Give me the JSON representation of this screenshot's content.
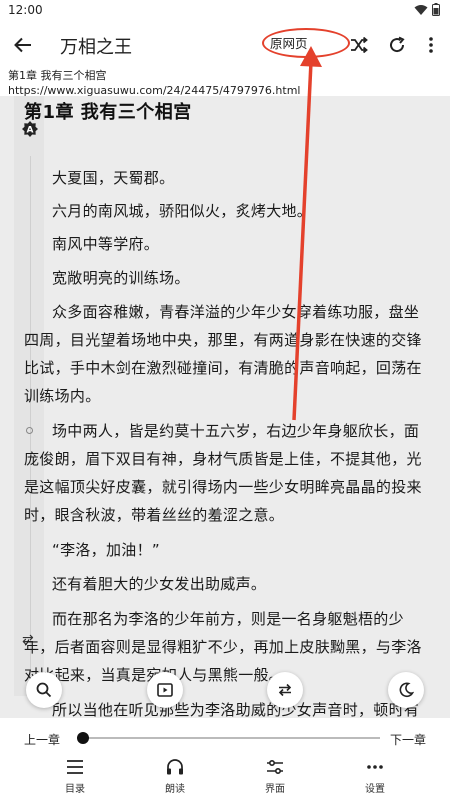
{
  "status_bar": {
    "time": "12:00"
  },
  "app_bar": {
    "title": "万相之王",
    "origin_page_label": "原网页",
    "icons": [
      "back-arrow-icon",
      "shuffle-icon",
      "refresh-icon",
      "more-vert-icon"
    ]
  },
  "chapter_info": {
    "chapter_title": "第1章 我有三个相宫",
    "url": "https://www.xiguasuwu.com/24/24475/4797976.html"
  },
  "reading": {
    "heading": "第1章 我有三个相宫",
    "auto_badge": "A",
    "paragraphs": [
      "大夏国，天蜀郡。",
      "六月的南风城，骄阳似火，炙烤大地。",
      "南风中等学府。",
      "宽敞明亮的训练场。",
      "众多面容稚嫩，青春洋溢的少年少女穿着练功服，盘坐",
      "四周，目光望着场地中央，那里，有两道身影在快速的交锋",
      "比试，手中木剑在激烈碰撞间，有清脆的声音响起，回荡在",
      "训练场内。",
      "场中两人，皆是约莫十五六岁，右边少年身躯欣长，面",
      "庞俊朗，眉下双目有神，身材气质皆是上佳，不提其他，光",
      "是这幅顶尖好皮囊，就引得场内一些少女明眸亮晶晶的投来",
      "时，眼含秋波，带着丝丝的羞涩之意。",
      "“李洛，加油！”",
      "还有着胆大的少女发出助威声。",
      "而在那名为李洛的少年前方，则是一名身躯魁梧的少",
      "年，后者面容则是显得粗犷不少，再加上皮肤黝黑，与李洛",
      "对比起来，当真是宛如人与黑熊一般。",
      "所以当他在听见那些为李洛助威的少女声音时，顿时有"
    ]
  },
  "progress": {
    "prev_label": "上一章",
    "next_label": "下一章",
    "fraction": 0.0
  },
  "bottom_nav": [
    {
      "label": "目录",
      "icon": "menu-icon"
    },
    {
      "label": "朗读",
      "icon": "headphones-icon"
    },
    {
      "label": "界面",
      "icon": "sliders-icon"
    },
    {
      "label": "设置",
      "icon": "more-horiz-icon"
    }
  ],
  "colors": {
    "annotation_red": "#e4412c",
    "reading_bg": "#ececec"
  }
}
